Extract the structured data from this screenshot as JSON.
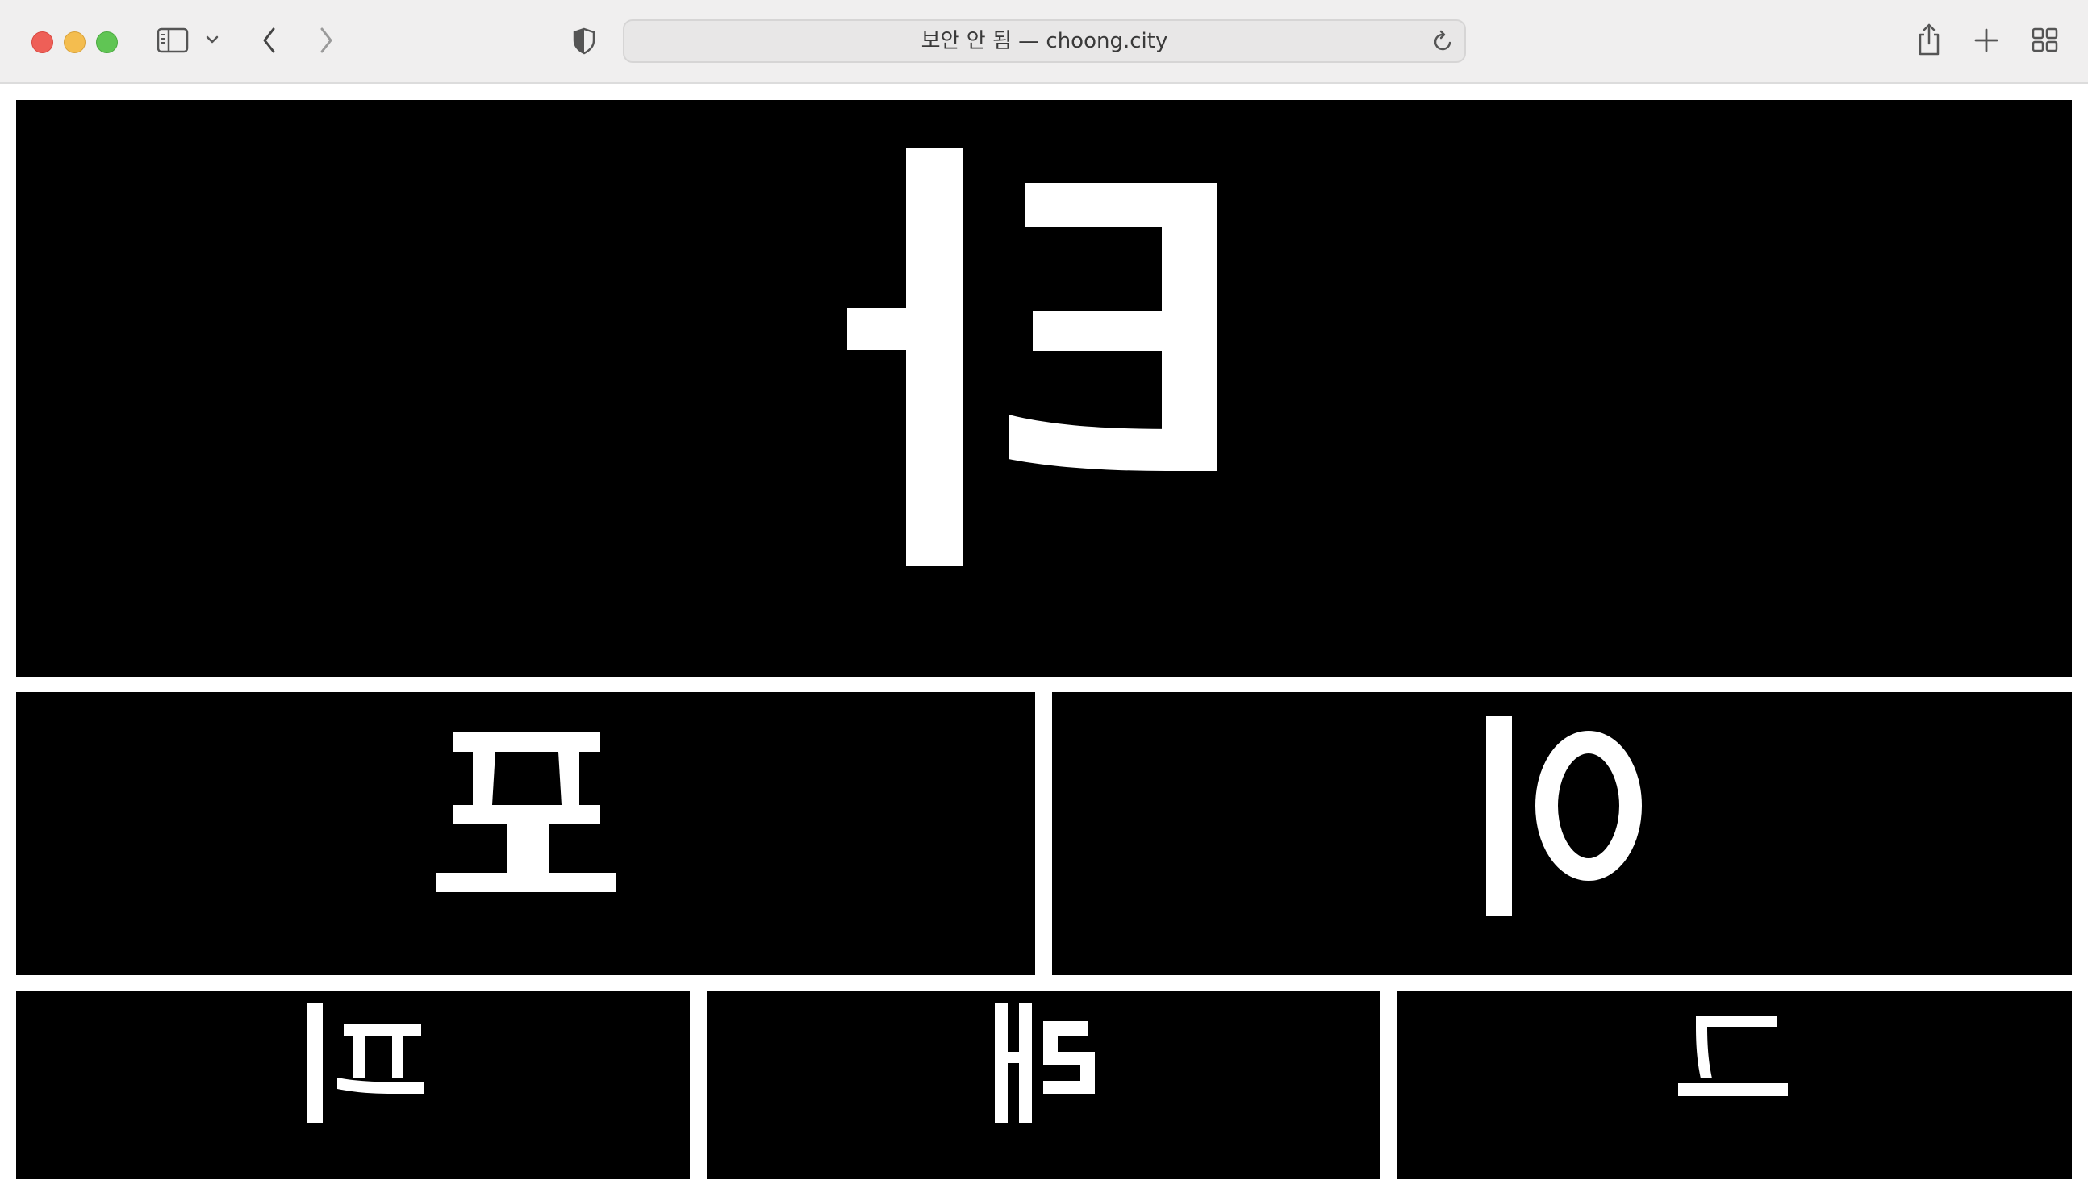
{
  "browser": {
    "address_bar": "보안 안 됨 — choong.city",
    "icons": [
      "close-button",
      "minimize-button",
      "zoom-button",
      "sidebar-icon",
      "chevron-down-icon",
      "back-arrow-icon",
      "forward-arrow-icon",
      "shield-icon",
      "reload-icon",
      "share-icon",
      "plus-icon",
      "tab-overview-icon"
    ]
  },
  "page": {
    "background": "#000000",
    "glyph_color": "#ffffff",
    "panels": [
      {
        "id": "top",
        "glyph_label": "mirrored 커"
      },
      {
        "id": "middle-left",
        "glyph_label": "mirrored 포"
      },
      {
        "id": "middle-right",
        "glyph_label": "mirrored 이"
      },
      {
        "id": "bottom-left",
        "glyph_label": "mirrored 피"
      },
      {
        "id": "bottom-center",
        "glyph_label": "mirrored 쉐"
      },
      {
        "id": "bottom-right",
        "glyph_label": "mirrored 드"
      }
    ]
  }
}
